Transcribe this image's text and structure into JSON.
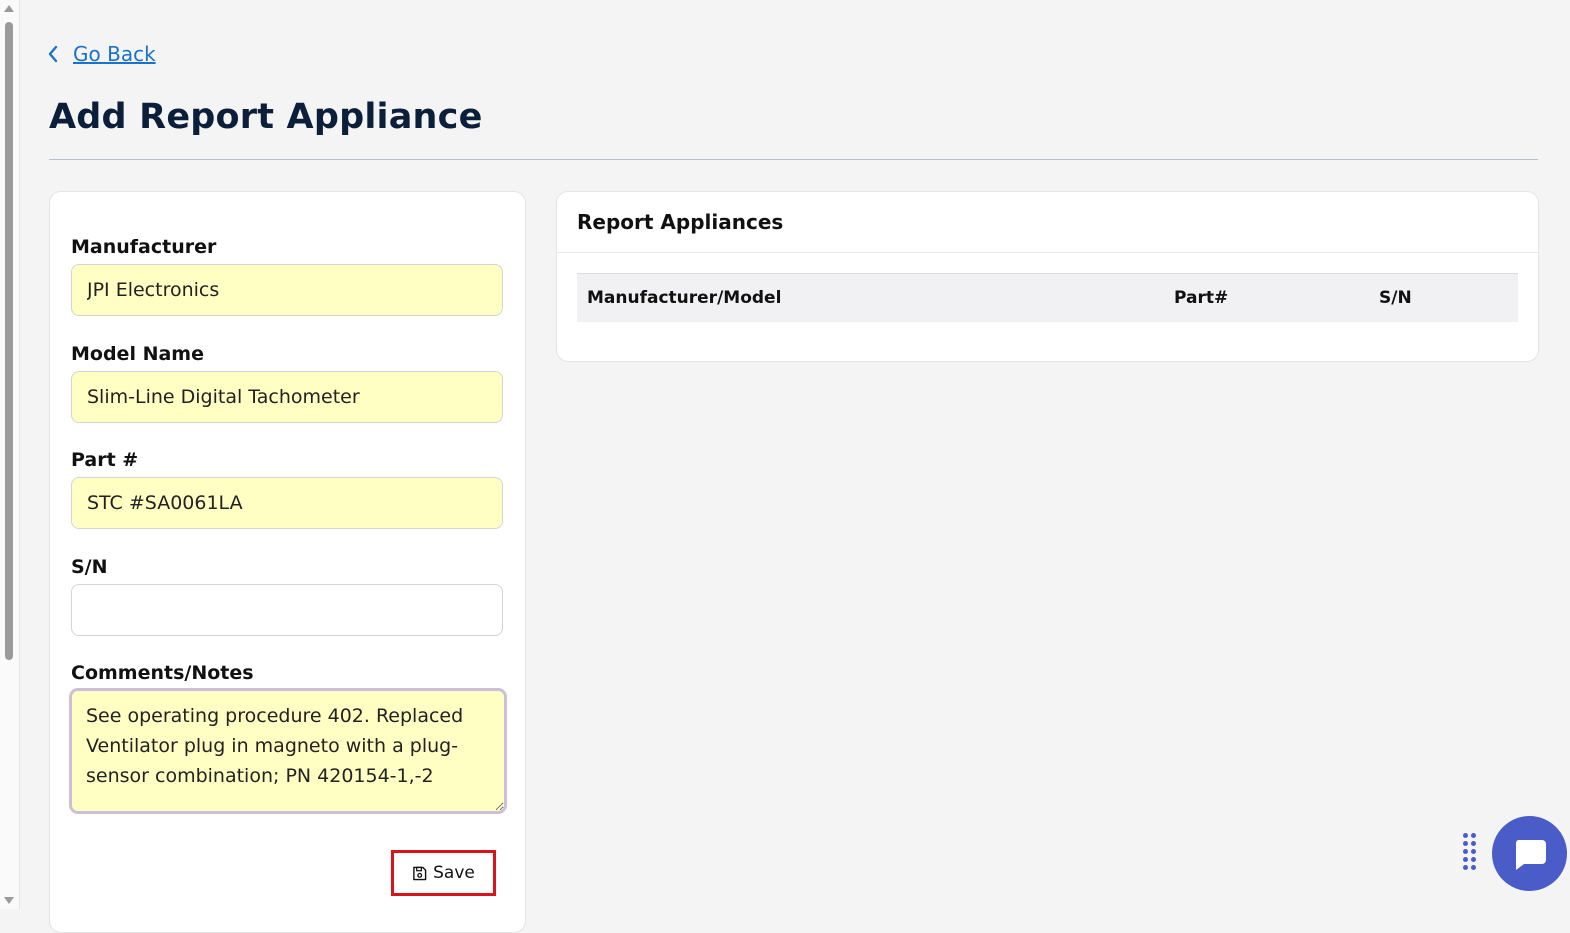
{
  "nav": {
    "go_back_label": "Go Back"
  },
  "page": {
    "title": "Add Report Appliance"
  },
  "form": {
    "manufacturer": {
      "label": "Manufacturer",
      "value": "JPI Electronics"
    },
    "model_name": {
      "label": "Model Name",
      "value": "Slim-Line Digital Tachometer"
    },
    "part_number": {
      "label": "Part #",
      "value": "STC #SA0061LA"
    },
    "serial_number": {
      "label": "S/N",
      "value": ""
    },
    "comments": {
      "label": "Comments/Notes",
      "value": "See operating procedure 402. Replaced Ventilator plug in magneto with a plug-sensor combination; PN 420154-1,-2"
    },
    "save_label": "Save"
  },
  "report_appliances": {
    "title": "Report Appliances",
    "columns": [
      "Manufacturer/Model",
      "Part#",
      "S/N"
    ],
    "rows": []
  },
  "colors": {
    "accent": "#1a73c8",
    "title": "#0b1f3a",
    "filled_input_bg": "#ffffc4",
    "save_highlight": "#d7141a",
    "chat_widget": "#4a5cc8"
  },
  "icons": {
    "back": "chevron-left-icon",
    "save": "floppy-disk-icon",
    "chat": "chat-bubble-icon",
    "drag": "drag-handle-icon"
  }
}
